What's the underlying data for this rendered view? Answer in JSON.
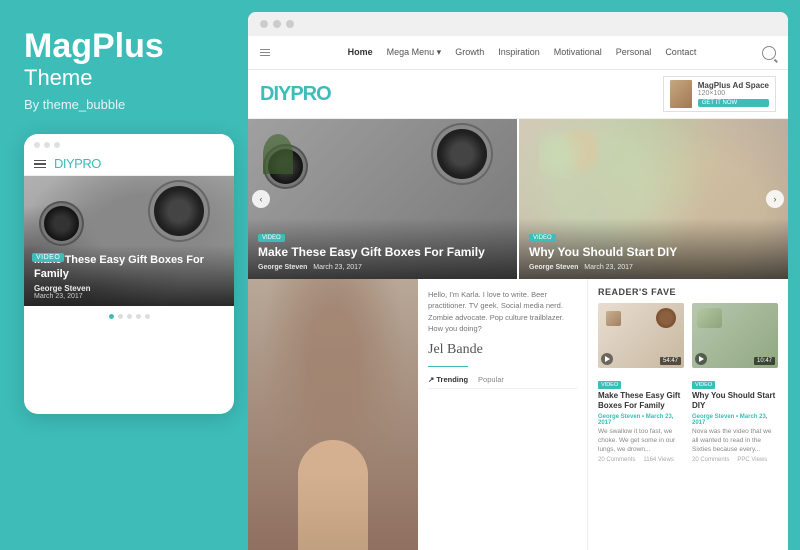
{
  "brand": {
    "name": "MagPlus",
    "subtitle": "Theme",
    "by": "By theme_bubble"
  },
  "mobile": {
    "logo": "DIYPRO",
    "video_badge": "VIDEO",
    "card_title": "Make These Easy Gift Boxes For Family",
    "author": "George Steven",
    "date": "March 23, 2017"
  },
  "nav": {
    "links": [
      "Home",
      "Mega Menu ▾",
      "Growth",
      "Inspiration",
      "Motivational",
      "Personal",
      "Contact"
    ]
  },
  "site": {
    "logo": "DIYPRO"
  },
  "ad": {
    "title": "MagPlus Ad Space",
    "size": "120×100",
    "button": "GET IT NOW"
  },
  "hero": {
    "slide1": {
      "video_badge": "VIDEO",
      "title": "Make These Easy Gift Boxes For Family",
      "author": "George Steven",
      "date": "March 23, 2017"
    },
    "slide2": {
      "video_badge": "VIDEO",
      "title": "Why You Should Start DIY",
      "author": "George Steven",
      "date": "March 23, 2017"
    },
    "arrow_left": "‹",
    "arrow_right": "›"
  },
  "bio": {
    "text": "Hello, I'm Karla. I love to write. Beer practitioner. TV geek. Social media nerd. Zombie advocate. Pop culture trailblazer. How you doing?",
    "signature": "Jel Bande"
  },
  "trending": {
    "tab1": "↗ Trending",
    "tab2": "Popular"
  },
  "readers_fave": {
    "section_title": "Reader's Fave",
    "cards": [
      {
        "video_badge": "VIDEO",
        "duration": "54:47",
        "title": "Make These Easy Gift Boxes For Family",
        "author": "George Steven • March 23, 2017",
        "excerpt": "We swallow it too fast, we choke. We get some in our lungs, we drown...",
        "comments": "20 Comments",
        "views": "1164 Views"
      },
      {
        "video_badge": "VIDEO",
        "duration": "10:47",
        "title": "Why You Should Start DIY",
        "author": "George Steven • March 23, 2017",
        "excerpt": "Nova was the video that we all wanted to read in the Sixties because every...",
        "comments": "20 Comments",
        "views": "PPC Views"
      }
    ]
  }
}
